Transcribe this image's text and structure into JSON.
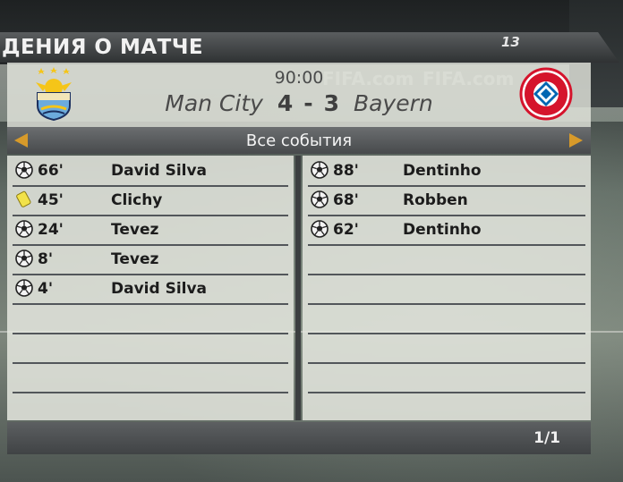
{
  "header": {
    "title": "ДЕНИЯ О МАТЧЕ",
    "page_number": "13"
  },
  "match": {
    "time": "90:00",
    "home_team": "Man City",
    "away_team": "Bayern",
    "home_score": "4",
    "separator": "-",
    "away_score": "3"
  },
  "events_bar": {
    "title": "Все события"
  },
  "home_events": [
    {
      "icon": "ball-icon",
      "minute": "66'",
      "player": "David Silva"
    },
    {
      "icon": "yellow-card-icon",
      "minute": "45'",
      "player": "Clichy"
    },
    {
      "icon": "ball-icon",
      "minute": "24'",
      "player": "Tevez"
    },
    {
      "icon": "ball-icon",
      "minute": "8'",
      "player": "Tevez"
    },
    {
      "icon": "ball-icon",
      "minute": "4'",
      "player": "David Silva"
    }
  ],
  "away_events": [
    {
      "icon": "ball-icon",
      "minute": "88'",
      "player": "Dentinho"
    },
    {
      "icon": "ball-icon",
      "minute": "68'",
      "player": "Robben"
    },
    {
      "icon": "ball-icon",
      "minute": "62'",
      "player": "Dentinho"
    }
  ],
  "pager": {
    "text": "1/1"
  },
  "colors": {
    "accent_arrow": "#d79a2a",
    "card_yellow": "#f2e24a",
    "bayern_red": "#d5142c",
    "city_blue": "#6cabdd"
  }
}
